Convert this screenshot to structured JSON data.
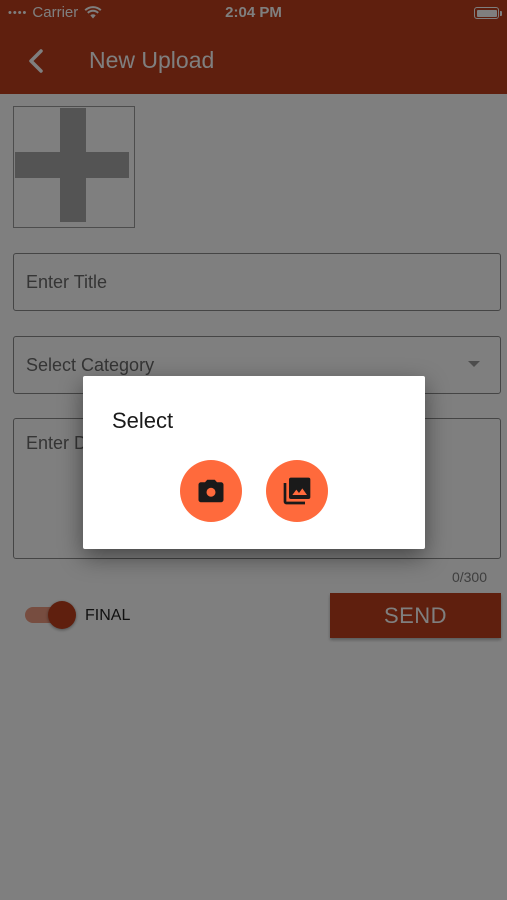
{
  "status_bar": {
    "carrier": "Carrier",
    "time": "2:04 PM",
    "signal_dots": "••••"
  },
  "toolbar": {
    "title": "New Upload",
    "back_icon": "chevron-left-icon"
  },
  "form": {
    "image_placeholder_icon": "plus-icon",
    "title_placeholder": "Enter Title",
    "category_placeholder": "Select Category",
    "description_placeholder": "Enter D",
    "char_counter": "0/300",
    "final_toggle": {
      "label": "FINAL",
      "on": true
    },
    "send_label": "SEND"
  },
  "dialog": {
    "title": "Select",
    "options": [
      {
        "icon": "camera-icon"
      },
      {
        "icon": "photo-library-icon"
      }
    ]
  },
  "colors": {
    "primary": "#bf3f1c",
    "accent": "#ff6a3c",
    "toggle_track": "#ef9a80"
  }
}
